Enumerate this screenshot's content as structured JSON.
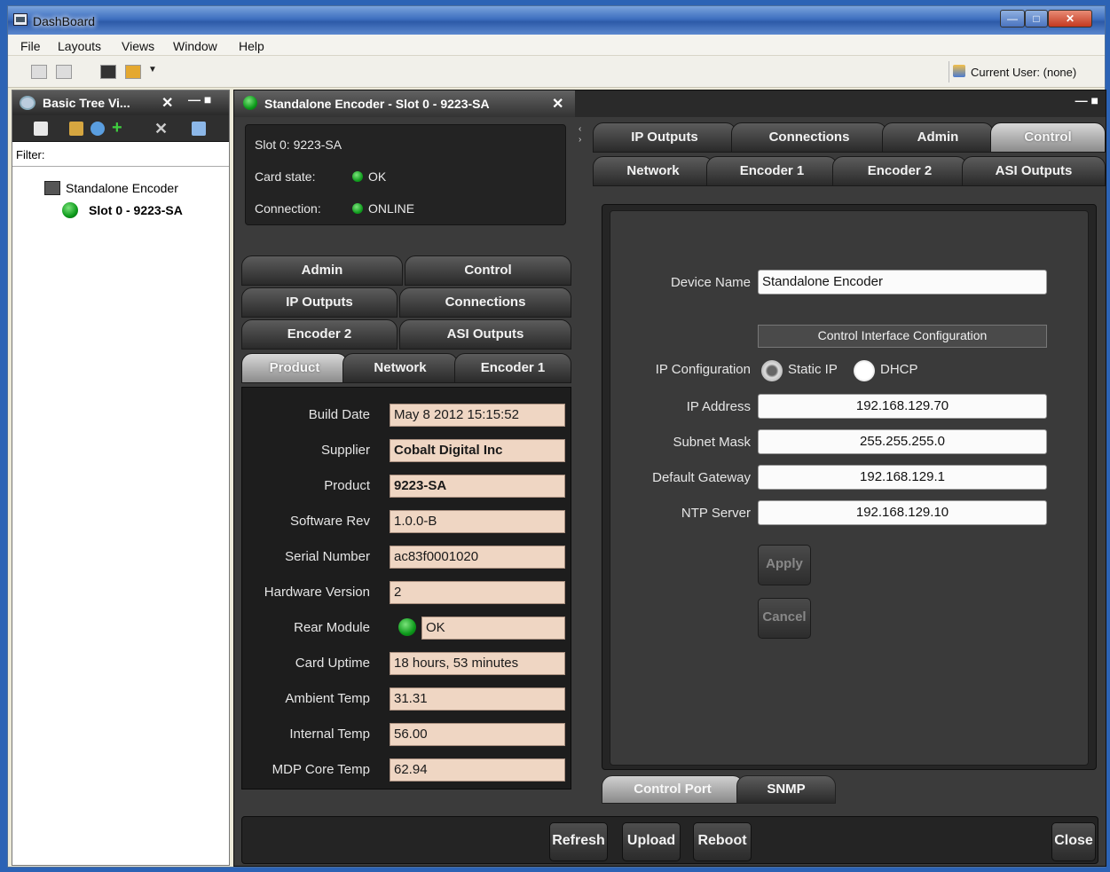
{
  "window": {
    "title": "DashBoard"
  },
  "menu": [
    "File",
    "Layouts",
    "Views",
    "Window",
    "Help"
  ],
  "toolbar": {
    "current_user": "Current User: (none)"
  },
  "tree": {
    "tab_title": "Basic Tree Vi...",
    "filter_label": "Filter:",
    "root_label": "Standalone Encoder",
    "child_label": "Slot 0 - 9223-SA"
  },
  "encoder": {
    "tab_title": "Standalone Encoder - Slot 0 - 9223-SA",
    "slot_label": "Slot 0: 9223-SA",
    "card_state_label": "Card state:",
    "card_state_value": "OK",
    "connection_label": "Connection:",
    "connection_value": "ONLINE"
  },
  "left_tabs": {
    "row1": [
      "Admin",
      "Control"
    ],
    "row2": [
      "IP Outputs",
      "Connections"
    ],
    "row3": [
      "Encoder 2",
      "ASI Outputs"
    ],
    "row4": [
      "Product",
      "Network",
      "Encoder 1"
    ]
  },
  "product": {
    "fields": [
      {
        "label": "Build Date",
        "value": "May  8 2012 15:15:52"
      },
      {
        "label": "Supplier",
        "value": "Cobalt Digital Inc"
      },
      {
        "label": "Product",
        "value": "9223-SA"
      },
      {
        "label": "Software Rev",
        "value": "1.0.0-B"
      },
      {
        "label": "Serial Number",
        "value": "ac83f0001020"
      },
      {
        "label": "Hardware Version",
        "value": "2"
      },
      {
        "label": "Rear Module",
        "value": "OK"
      },
      {
        "label": "Card Uptime",
        "value": "18 hours, 53 minutes"
      },
      {
        "label": "Ambient Temp",
        "value": "31.31"
      },
      {
        "label": "Internal Temp",
        "value": "56.00"
      },
      {
        "label": "MDP Core Temp",
        "value": "62.94"
      }
    ]
  },
  "right_tabs": {
    "row1": [
      "IP Outputs",
      "Connections",
      "Admin",
      "Control"
    ],
    "row2": [
      "Network",
      "Encoder 1",
      "Encoder 2",
      "ASI Outputs"
    ]
  },
  "control": {
    "device_name_label": "Device Name",
    "device_name_value": "Standalone Encoder",
    "section_title": "Control Interface Configuration",
    "ip_config_label": "IP Configuration",
    "radio_static": "Static IP",
    "radio_dhcp": "DHCP",
    "ip_address_label": "IP Address",
    "ip_address_value": "192.168.129.70",
    "subnet_label": "Subnet Mask",
    "subnet_value": "255.255.255.0",
    "gateway_label": "Default Gateway",
    "gateway_value": "192.168.129.1",
    "ntp_label": "NTP Server",
    "ntp_value": "192.168.129.10",
    "apply": "Apply",
    "cancel": "Cancel",
    "subtabs": [
      "Control Port",
      "SNMP"
    ]
  },
  "actions": [
    "Refresh",
    "Upload",
    "Reboot",
    "Close"
  ]
}
